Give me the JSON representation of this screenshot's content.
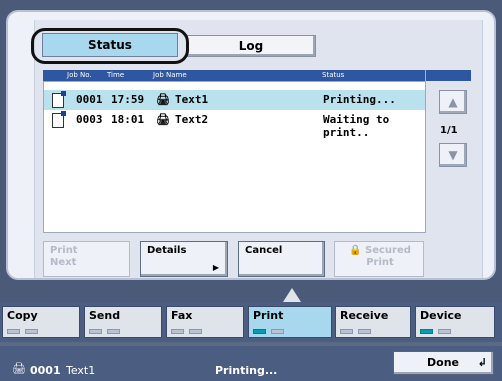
{
  "tabs": {
    "status": "Status",
    "log": "Log"
  },
  "table": {
    "headers": [
      "Job No.",
      "Time",
      "Job Name",
      "Status"
    ],
    "rows": [
      {
        "job_no": "0001",
        "time": "17:59",
        "name": "Text1",
        "status": "Printing...",
        "selected": true
      },
      {
        "job_no": "0003",
        "time": "18:01",
        "name": "Text2",
        "status": "Waiting to print..",
        "selected": false
      }
    ]
  },
  "pager": {
    "page": "1/1",
    "up": "▲",
    "down": "▼"
  },
  "actions": {
    "print_next_1": "Print",
    "print_next_2": "Next",
    "details": "Details",
    "details_arrow": "▶",
    "cancel": "Cancel",
    "secured_1": "Secured",
    "secured_2": "Print"
  },
  "modes": {
    "copy": "Copy",
    "send": "Send",
    "fax": "Fax",
    "print": "Print",
    "receive": "Receive",
    "device": "Device",
    "active": "print"
  },
  "statusbar": {
    "job_no": "0001",
    "job_name": "Text1",
    "state": "Printing...",
    "done": "Done"
  }
}
